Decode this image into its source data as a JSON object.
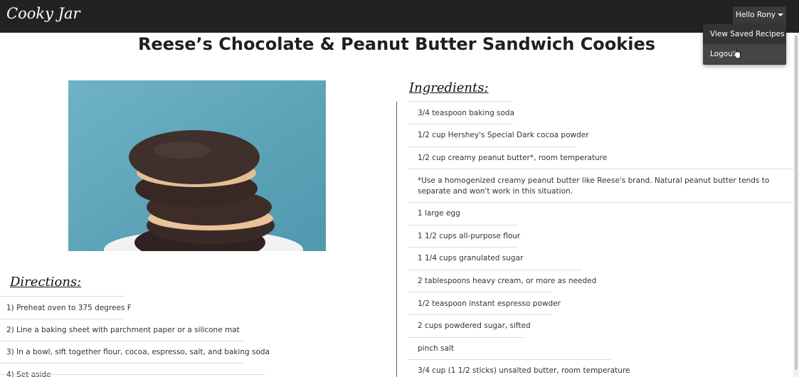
{
  "brand": "Cooky Jar",
  "user_menu": {
    "toggle_label": "Hello Rony",
    "items": [
      "View Saved Recipes",
      "Logout"
    ]
  },
  "recipe": {
    "title": "Reese’s Chocolate & Peanut Butter Sandwich Cookies",
    "directions_heading": "Directions:",
    "ingredients_heading": "Ingredients:",
    "directions": [
      "1) Preheat oven to 375 degrees F",
      "2) Line a baking sheet with parchment paper or a silicone mat",
      "3) In a bowl, sift together flour, cocoa, espresso, salt, and baking soda",
      "4) Set aside"
    ],
    "ingredients": [
      "3/4 teaspoon baking soda",
      "1/2 cup Hershey's Special Dark cocoa powder",
      "1/2 cup creamy peanut butter*, room temperature",
      "*Use a homogenized creamy peanut butter like Reese's brand. Natural peanut butter tends to separate and won't work in this situation.",
      "1 large egg",
      "1 1/2 cups all-purpose flour",
      "1 1/4 cups granulated sugar",
      "2 tablespoons heavy cream, or more as needed",
      "1/2 teaspoon instant espresso powder",
      "2 cups powdered sugar, sifted",
      "pinch salt",
      "3/4 cup (1 1/2 sticks) unsalted butter, room temperature"
    ]
  }
}
